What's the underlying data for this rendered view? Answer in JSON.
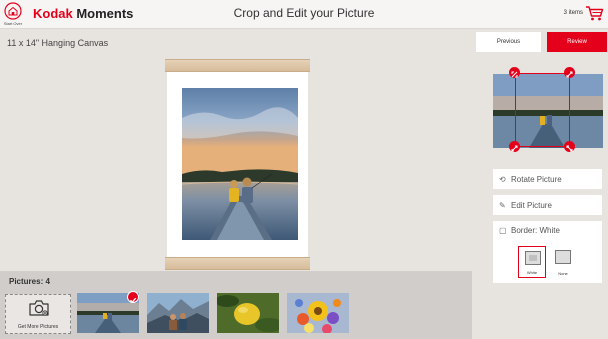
{
  "header": {
    "start_over_label": "Start Over",
    "brand_kodak": "Kodak",
    "brand_moments": " Moments",
    "title": "Crop and Edit your Picture",
    "cart_count": "3 items"
  },
  "product": {
    "title": "11 x 14\" Hanging Canvas"
  },
  "strip": {
    "label": "Pictures: 4",
    "get_more_label": "Get More Pictures",
    "thumbnails": [
      {
        "name": "thumb-lake-kids",
        "selected": true
      },
      {
        "name": "thumb-mountain-people",
        "selected": false
      },
      {
        "name": "thumb-lemon",
        "selected": false
      },
      {
        "name": "thumb-flowers",
        "selected": false
      }
    ]
  },
  "nav": {
    "previous_label": "Previous",
    "review_label": "Review"
  },
  "options": {
    "rotate_label": "Rotate Picture",
    "edit_label": "Edit Picture",
    "border_label": "Border: White",
    "border_choices": [
      {
        "label": "White",
        "selected": true
      },
      {
        "label": "None",
        "selected": false
      }
    ]
  },
  "colors": {
    "accent": "#e4001b",
    "background": "#e7e3df",
    "strip_background": "#d0cdca"
  },
  "icons": {
    "start_over": "home-icon",
    "cart": "cart-icon",
    "camera": "camera-icon",
    "rotate": "rotate-icon",
    "edit": "edit-icon",
    "border": "border-icon",
    "check": "check-icon",
    "crop_handle": "resize-arrow-icon"
  }
}
